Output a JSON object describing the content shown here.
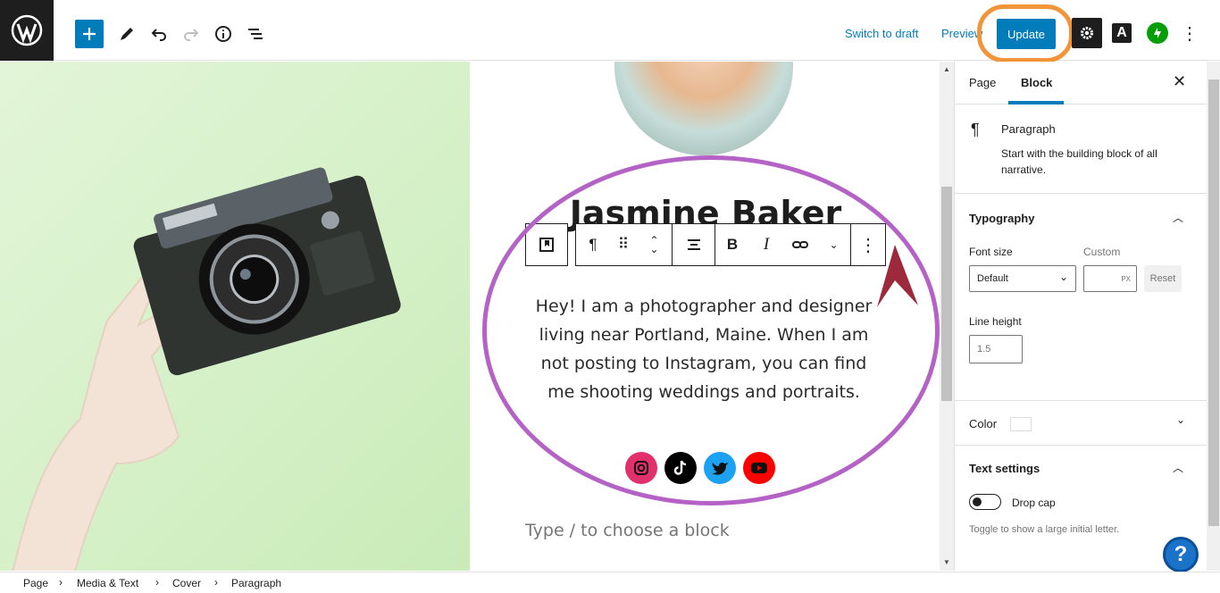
{
  "topbar": {
    "switch_to_draft": "Switch to draft",
    "preview": "Preview",
    "update": "Update",
    "a_label": "A"
  },
  "canvas": {
    "heading": "Jasmine Baker",
    "paragraph": "Hey! I am a photographer and designer living near Portland, Maine. When I am not posting to Instagram, you can find me shooting weddings and portraits.",
    "appender_placeholder": "Type / to choose a block"
  },
  "sidebar": {
    "tabs": [
      "Page",
      "Block"
    ],
    "block_name": "Paragraph",
    "block_desc": "Start with the building block of all narrative.",
    "typography": {
      "title": "Typography",
      "font_size_label": "Font size",
      "custom_label": "Custom",
      "font_size_value": "Default",
      "custom_unit": "PX",
      "reset": "Reset",
      "line_height_label": "Line height",
      "line_height_placeholder": "1.5"
    },
    "color_label": "Color",
    "text_settings": {
      "title": "Text settings",
      "drop_cap": "Drop cap",
      "drop_cap_help": "Toggle to show a large initial letter."
    },
    "help": "?"
  },
  "breadcrumbs": [
    "Page",
    "Media & Text",
    "Cover",
    "Paragraph"
  ],
  "colors": {
    "accent": "#007cba",
    "highlight_orange": "#f2953a",
    "highlight_purple": "#b562c6",
    "instagram": "#e1306c",
    "tiktok": "#000000",
    "twitter": "#1da1f2",
    "youtube": "#ff0000"
  }
}
